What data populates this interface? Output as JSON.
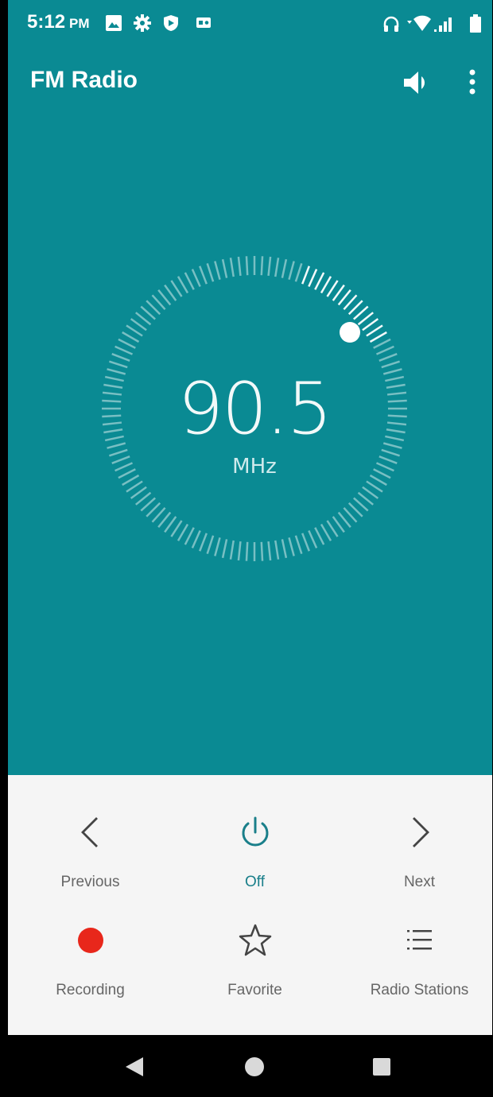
{
  "status_bar": {
    "time": "5:12",
    "ampm": "PM",
    "icons": [
      "image-icon",
      "settings-icon",
      "shield-icon",
      "radio-icon",
      "headset-icon",
      "wifi-icon",
      "signal-icon",
      "battery-icon"
    ]
  },
  "app_bar": {
    "title": "FM Radio",
    "actions": [
      "speaker-icon",
      "more-vert-icon"
    ]
  },
  "tuner": {
    "frequency": "90.5",
    "unit": "MHz"
  },
  "controls": {
    "previous": "Previous",
    "off": "Off",
    "next": "Next",
    "recording": "Recording",
    "favorite": "Favorite",
    "stations": "Radio Stations"
  },
  "colors": {
    "background": "#0a8a93",
    "panel": "#f5f5f5",
    "accent": "#1a7f8a",
    "record": "#e8271b"
  },
  "nav_bar": {
    "buttons": [
      "back-icon",
      "home-icon",
      "recents-icon"
    ]
  }
}
